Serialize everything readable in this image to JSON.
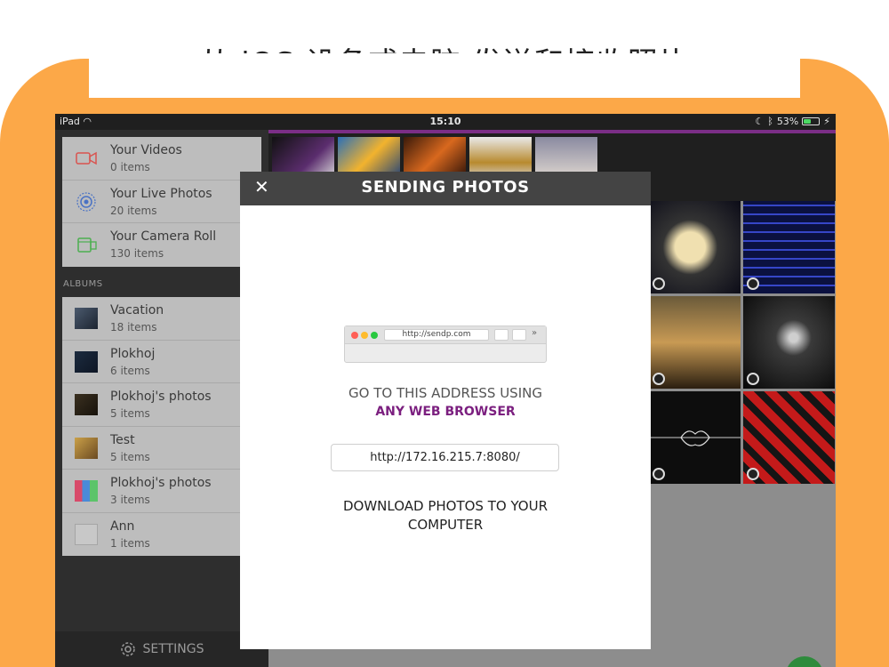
{
  "headline": "从 iOS 设备或电脑 发送和接收照片",
  "status": {
    "device": "iPad",
    "time": "15:10",
    "battery": "53%",
    "battery_level": 0.53
  },
  "sources": [
    {
      "title": "Your Videos",
      "count": "0 items",
      "icon": "video-icon"
    },
    {
      "title": "Your Live Photos",
      "count": "20 items",
      "icon": "live-photos-icon"
    },
    {
      "title": "Your Camera Roll",
      "count": "130 items",
      "icon": "camera-roll-icon"
    }
  ],
  "albums_label": "ALBUMS",
  "albums": [
    {
      "title": "Vacation",
      "count": "18 items"
    },
    {
      "title": "Plokhoj",
      "count": "6 items"
    },
    {
      "title": "Plokhoj's photos",
      "count": "5 items"
    },
    {
      "title": "Test",
      "count": "5 items"
    },
    {
      "title": "Plokhoj's photos",
      "count": "3 items"
    },
    {
      "title": "Ann",
      "count": "1 items"
    }
  ],
  "settings_label": "SETTINGS",
  "modal": {
    "title": "SENDING PHOTOS",
    "browser_url": "http://sendp.com",
    "go_text": "GO TO THIS ADDRESS USING",
    "browser_text": "ANY WEB BROWSER",
    "address": "http://172.16.215.7:8080/",
    "download_text": "DOWNLOAD PHOTOS TO YOUR COMPUTER"
  },
  "colors": {
    "accent": "#7b2e86",
    "frame": "#fca848",
    "link": "#7b1f7f"
  }
}
